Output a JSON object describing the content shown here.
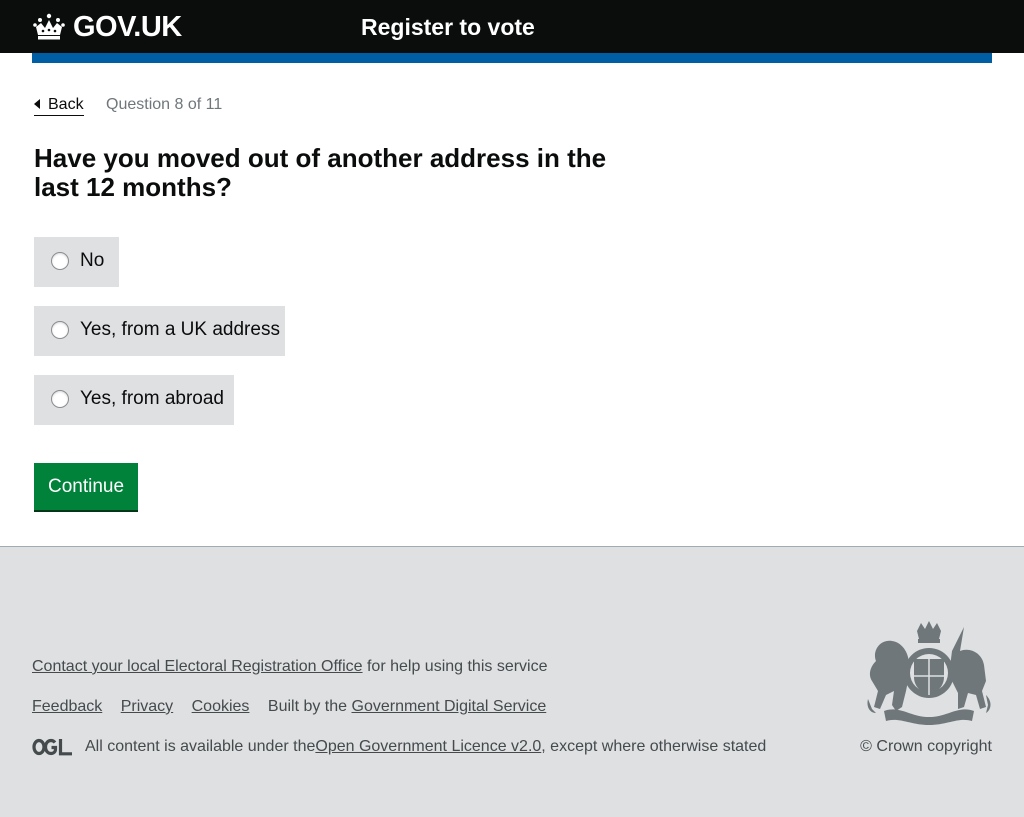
{
  "header": {
    "logo_text": "GOV.UK",
    "logo_icon": "crown-icon",
    "service_name": "Register to vote",
    "colors": {
      "header_bg": "#0b0c0c",
      "bar": "#005ea5"
    }
  },
  "nav": {
    "back_label": "Back",
    "progress": "Question 8 of 11"
  },
  "form": {
    "question": "Have you moved out of another address in the last 12 months?",
    "options": [
      {
        "label": "No",
        "selected": false
      },
      {
        "label": "Yes, from a UK address",
        "selected": false
      },
      {
        "label": "Yes, from abroad",
        "selected": false
      }
    ],
    "continue_label": "Continue",
    "colors": {
      "button": "#00823b",
      "option_bg": "#dee0e2"
    }
  },
  "footer": {
    "contact_link": "Contact your local Electoral Registration Office",
    "contact_suffix": " for help using this service",
    "links": [
      "Feedback",
      "Privacy",
      "Cookies"
    ],
    "built_by_prefix": "Built by the ",
    "built_by_link": "Government Digital Service",
    "ogl_logo": "OGL",
    "licence_prefix": "All content is available under the ",
    "licence_link": "Open Government Licence v2.0",
    "licence_suffix": ", except where otherwise stated",
    "crest_icon": "royal-coat-of-arms-icon",
    "copyright": "© Crown copyright",
    "colors": {
      "footer_bg": "#dee0e2",
      "text": "#454a4c"
    }
  }
}
